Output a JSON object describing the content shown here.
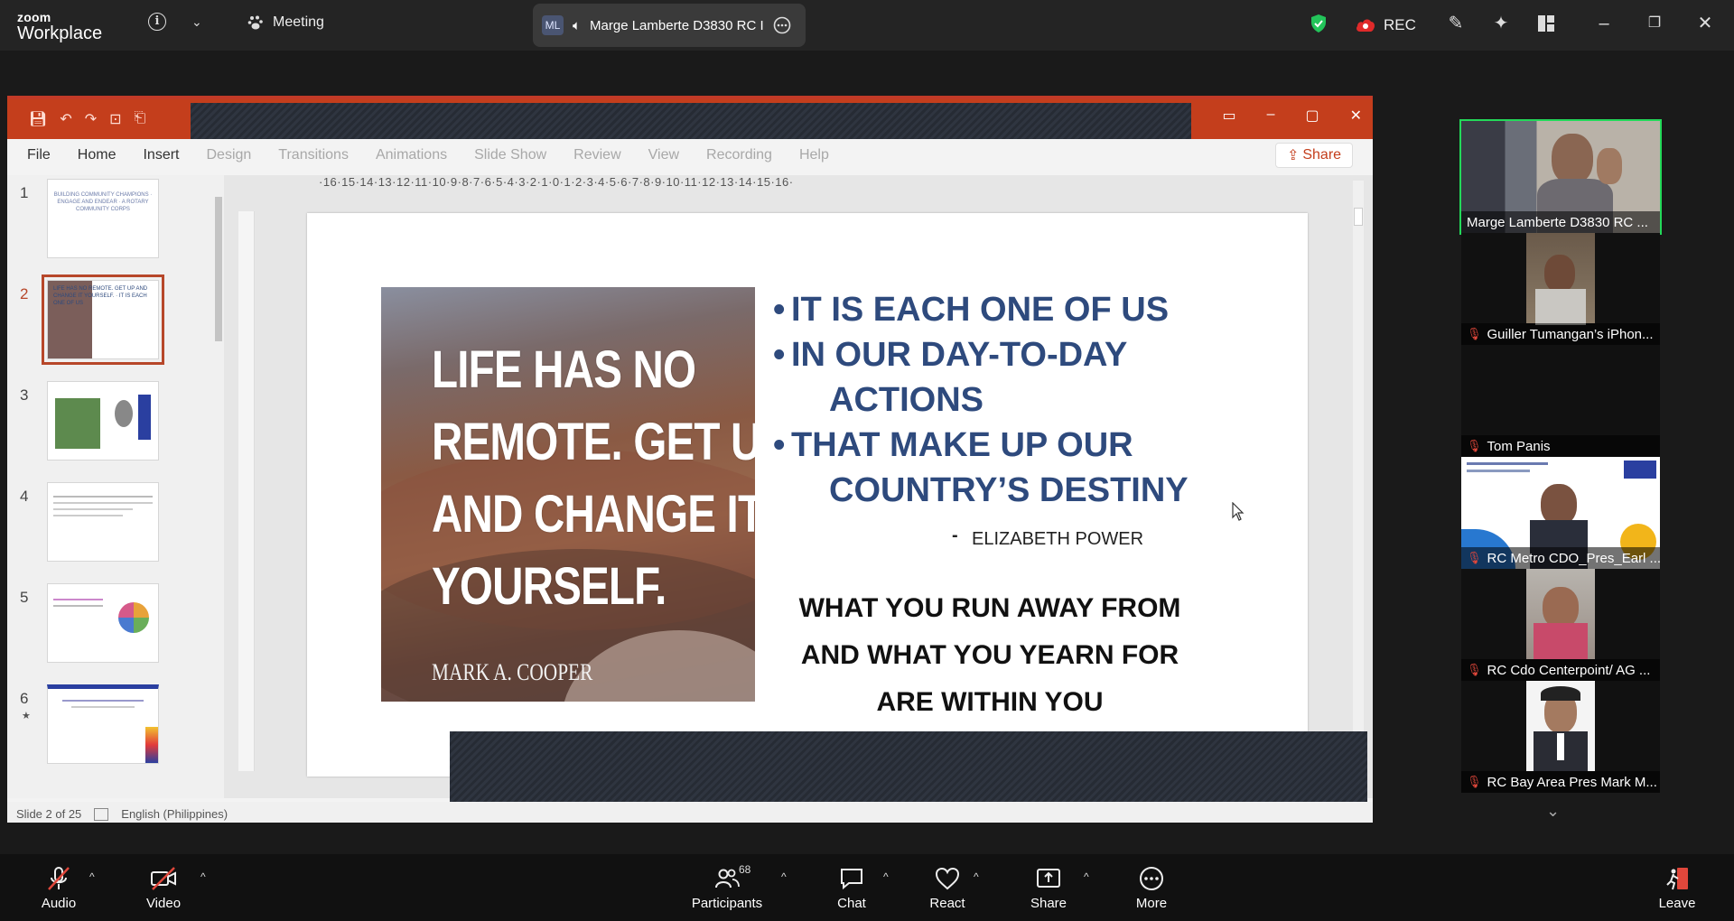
{
  "app": {
    "brand_top": "zoom",
    "brand_bottom": "Workplace",
    "meeting_label": "Meeting"
  },
  "share_pill": {
    "initials": "ML",
    "presenter": "Marge Lamberte  D3830 RC I"
  },
  "topbar": {
    "rec_label": "REC"
  },
  "ppt": {
    "tabs": [
      "File",
      "Home",
      "Insert",
      "Design",
      "Transitions",
      "Animations",
      "Slide Show",
      "Review",
      "View",
      "Recording",
      "Help"
    ],
    "share_label": "Share",
    "ruler": "·16·15·14·13·12·11·10·9·8·7·6·5·4·3·2·1·0·1·2·3·4·5·6·7·8·9·10·11·12·13·14·15·16·",
    "thumbnails": [
      {
        "num": "1",
        "text": "BUILDING COMMUNITY CHAMPIONS · ENGAGE AND ENDEAR · A ROTARY COMMUNITY CORPS"
      },
      {
        "num": "2",
        "text": "LIFE HAS NO REMOTE. GET UP AND CHANGE IT YOURSELF. · IT IS EACH ONE OF US"
      },
      {
        "num": "3",
        "text": ""
      },
      {
        "num": "4",
        "text": ""
      },
      {
        "num": "5",
        "text": ""
      },
      {
        "num": "6",
        "text": ""
      }
    ],
    "status": {
      "slide": "Slide 2 of 25",
      "language": "English (Philippines)"
    }
  },
  "slide": {
    "quote_lines": [
      "LIFE HAS NO",
      "REMOTE. GET UP",
      "AND CHANGE IT",
      "YOURSELF."
    ],
    "quote_author": "MARK A. COOPER",
    "bullet1": "IT IS EACH ONE OF US",
    "bullet2a": "IN OUR DAY-TO-DAY",
    "bullet2b": "ACTIONS",
    "bullet3a": "THAT MAKE UP OUR",
    "bullet3b": "COUNTRY’S DESTINY",
    "byline_dash": "-",
    "byline": "ELIZABETH POWER",
    "closing": [
      "WHAT YOU RUN AWAY FROM",
      "AND WHAT YOU YEARN FOR",
      "ARE WITHIN YOU"
    ]
  },
  "gallery": [
    {
      "name": "Marge Lamberte  D3830 RC ...",
      "muted": false,
      "speaking": true
    },
    {
      "name": "Guiller Tumangan’s iPhon...",
      "muted": true,
      "speaking": false
    },
    {
      "name": "Tom Panis",
      "muted": true,
      "speaking": false
    },
    {
      "name": "RC Metro CDO_Pres_Earl ...",
      "muted": true,
      "speaking": false
    },
    {
      "name": "RC Cdo Centerpoint/ AG ...",
      "muted": true,
      "speaking": false
    },
    {
      "name": "RC Bay Area Pres Mark M...",
      "muted": true,
      "speaking": false
    }
  ],
  "bottombar": {
    "audio": "Audio",
    "video": "Video",
    "participants": "Participants",
    "participant_count": "68",
    "chat": "Chat",
    "react": "React",
    "share": "Share",
    "more": "More",
    "leave": "Leave"
  }
}
